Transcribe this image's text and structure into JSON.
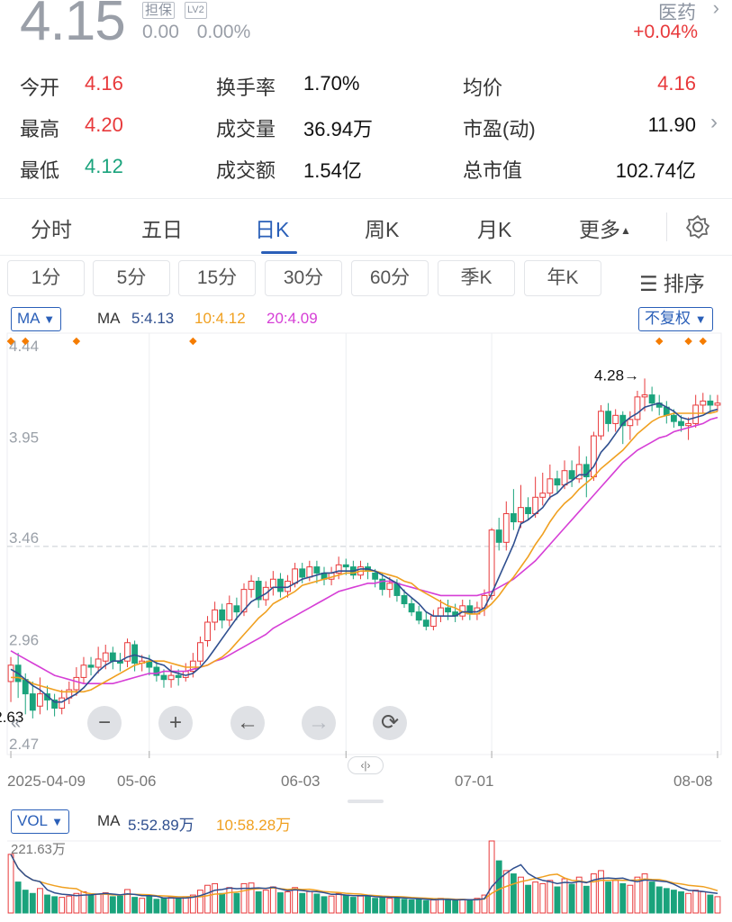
{
  "header": {
    "price": "4.15",
    "tags": [
      "担保",
      "LV2"
    ],
    "change": "0.00",
    "change_pct": "0.00%",
    "sector": "医药",
    "sector_pct": "+0.04%"
  },
  "quote": {
    "open": {
      "label": "今开",
      "value": "4.16"
    },
    "high": {
      "label": "最高",
      "value": "4.20"
    },
    "low": {
      "label": "最低",
      "value": "4.12"
    },
    "turnover": {
      "label": "换手率",
      "value": "1.70%"
    },
    "volume": {
      "label": "成交量",
      "value": "36.94万"
    },
    "amount": {
      "label": "成交额",
      "value": "1.54亿"
    },
    "avg": {
      "label": "均价",
      "value": "4.16"
    },
    "pe": {
      "label": "市盈(动)",
      "value": "11.90"
    },
    "mktcap": {
      "label": "总市值",
      "value": "102.74亿"
    }
  },
  "tabs": [
    "分时",
    "五日",
    "日K",
    "周K",
    "月K",
    "更多"
  ],
  "periods": [
    "1分",
    "5分",
    "15分",
    "30分",
    "60分",
    "季K",
    "年K"
  ],
  "sort_label": "排序",
  "ma": {
    "button": "MA",
    "label": "MA",
    "ma5": "5:4.13",
    "ma10": "10:4.12",
    "ma20": "20:4.09",
    "adjust": "不复权"
  },
  "vol": {
    "button": "VOL",
    "label": "MA",
    "ma5": "5:52.89万",
    "ma10": "10:58.28万",
    "max": "221.63万"
  },
  "chart_data": {
    "type": "candlestick",
    "y_ticks": [
      "4.44",
      "3.95",
      "3.46",
      "2.96",
      "2.47"
    ],
    "ylim": [
      2.47,
      4.44
    ],
    "x_ticks": [
      "2025-04-09",
      "05-06",
      "06-03",
      "07-01",
      "08-08"
    ],
    "annotations": {
      "high": "4.28",
      "low": "2.63"
    },
    "candles": [
      [
        2.8,
        2.88,
        2.7,
        2.92
      ],
      [
        2.88,
        2.8,
        2.72,
        2.94
      ],
      [
        2.81,
        2.74,
        2.64,
        2.84
      ],
      [
        2.74,
        2.66,
        2.62,
        2.8
      ],
      [
        2.68,
        2.74,
        2.64,
        2.82
      ],
      [
        2.74,
        2.71,
        2.66,
        2.78
      ],
      [
        2.71,
        2.67,
        2.63,
        2.74
      ],
      [
        2.67,
        2.72,
        2.64,
        2.76
      ],
      [
        2.72,
        2.76,
        2.69,
        2.8
      ],
      [
        2.76,
        2.82,
        2.73,
        2.87
      ],
      [
        2.82,
        2.88,
        2.79,
        2.92
      ],
      [
        2.88,
        2.87,
        2.83,
        2.92
      ],
      [
        2.87,
        2.91,
        2.84,
        2.97
      ],
      [
        2.9,
        2.94,
        2.86,
        2.98
      ],
      [
        2.94,
        2.9,
        2.86,
        2.97
      ],
      [
        2.9,
        2.89,
        2.85,
        2.94
      ],
      [
        2.9,
        2.99,
        2.87,
        3.01
      ],
      [
        2.98,
        2.89,
        2.85,
        3.0
      ],
      [
        2.89,
        2.9,
        2.85,
        2.93
      ],
      [
        2.9,
        2.87,
        2.83,
        2.93
      ],
      [
        2.87,
        2.83,
        2.8,
        2.9
      ],
      [
        2.83,
        2.81,
        2.77,
        2.86
      ],
      [
        2.81,
        2.83,
        2.77,
        2.88
      ],
      [
        2.83,
        2.82,
        2.78,
        2.86
      ],
      [
        2.82,
        2.85,
        2.8,
        2.89
      ],
      [
        2.85,
        2.9,
        2.82,
        2.94
      ],
      [
        2.9,
        2.99,
        2.88,
        3.02
      ],
      [
        3.0,
        3.09,
        2.97,
        3.12
      ],
      [
        3.09,
        3.15,
        3.05,
        3.19
      ],
      [
        3.15,
        3.1,
        3.06,
        3.18
      ],
      [
        3.1,
        3.18,
        3.07,
        3.22
      ],
      [
        3.17,
        3.14,
        3.1,
        3.21
      ],
      [
        3.14,
        3.25,
        3.12,
        3.28
      ],
      [
        3.25,
        3.29,
        3.21,
        3.32
      ],
      [
        3.29,
        3.2,
        3.16,
        3.31
      ],
      [
        3.2,
        3.26,
        3.17,
        3.29
      ],
      [
        3.26,
        3.3,
        3.22,
        3.34
      ],
      [
        3.3,
        3.24,
        3.21,
        3.33
      ],
      [
        3.24,
        3.29,
        3.21,
        3.32
      ],
      [
        3.28,
        3.35,
        3.26,
        3.38
      ],
      [
        3.35,
        3.31,
        3.28,
        3.38
      ],
      [
        3.31,
        3.36,
        3.29,
        3.39
      ],
      [
        3.36,
        3.33,
        3.28,
        3.39
      ],
      [
        3.33,
        3.3,
        3.27,
        3.36
      ],
      [
        3.3,
        3.33,
        3.27,
        3.36
      ],
      [
        3.33,
        3.37,
        3.3,
        3.41
      ],
      [
        3.37,
        3.36,
        3.32,
        3.4
      ],
      [
        3.36,
        3.32,
        3.3,
        3.39
      ],
      [
        3.32,
        3.36,
        3.3,
        3.39
      ],
      [
        3.36,
        3.34,
        3.3,
        3.38
      ],
      [
        3.33,
        3.3,
        3.26,
        3.35
      ],
      [
        3.3,
        3.25,
        3.22,
        3.33
      ],
      [
        3.25,
        3.28,
        3.21,
        3.31
      ],
      [
        3.28,
        3.22,
        3.19,
        3.3
      ],
      [
        3.22,
        3.18,
        3.16,
        3.25
      ],
      [
        3.18,
        3.14,
        3.12,
        3.21
      ],
      [
        3.14,
        3.1,
        3.08,
        3.17
      ],
      [
        3.1,
        3.07,
        3.05,
        3.14
      ],
      [
        3.07,
        3.12,
        3.05,
        3.15
      ],
      [
        3.12,
        3.16,
        3.09,
        3.2
      ],
      [
        3.16,
        3.14,
        3.1,
        3.2
      ],
      [
        3.14,
        3.12,
        3.09,
        3.18
      ],
      [
        3.12,
        3.17,
        3.1,
        3.2
      ],
      [
        3.17,
        3.13,
        3.1,
        3.2
      ],
      [
        3.13,
        3.16,
        3.1,
        3.19
      ],
      [
        3.16,
        3.22,
        3.12,
        3.25
      ],
      [
        3.22,
        3.54,
        3.2,
        3.55
      ],
      [
        3.54,
        3.48,
        3.44,
        3.6
      ],
      [
        3.48,
        3.62,
        3.44,
        3.68
      ],
      [
        3.62,
        3.58,
        3.54,
        3.74
      ],
      [
        3.58,
        3.65,
        3.55,
        3.76
      ],
      [
        3.65,
        3.62,
        3.59,
        3.7
      ],
      [
        3.62,
        3.7,
        3.6,
        3.8
      ],
      [
        3.7,
        3.72,
        3.66,
        3.82
      ],
      [
        3.72,
        3.79,
        3.69,
        3.86
      ],
      [
        3.79,
        3.76,
        3.72,
        3.83
      ],
      [
        3.76,
        3.83,
        3.74,
        3.88
      ],
      [
        3.83,
        3.79,
        3.75,
        3.88
      ],
      [
        3.79,
        3.86,
        3.77,
        3.95
      ],
      [
        3.86,
        3.8,
        3.7,
        3.9
      ],
      [
        3.8,
        4.0,
        3.78,
        4.02
      ],
      [
        4.0,
        4.12,
        3.98,
        4.15
      ],
      [
        4.12,
        4.06,
        4.02,
        4.16
      ],
      [
        4.06,
        4.1,
        4.02,
        4.13
      ],
      [
        4.1,
        4.05,
        3.96,
        4.12
      ],
      [
        4.05,
        4.08,
        3.98,
        4.12
      ],
      [
        4.08,
        4.19,
        4.05,
        4.22
      ],
      [
        4.19,
        4.2,
        4.12,
        4.28
      ],
      [
        4.2,
        4.16,
        4.12,
        4.24
      ],
      [
        4.16,
        4.14,
        4.1,
        4.2
      ],
      [
        4.14,
        4.1,
        4.06,
        4.17
      ],
      [
        4.1,
        4.07,
        4.04,
        4.13
      ],
      [
        4.07,
        4.05,
        4.02,
        4.1
      ],
      [
        4.05,
        4.06,
        3.98,
        4.09
      ],
      [
        4.06,
        4.15,
        4.04,
        4.2
      ],
      [
        4.15,
        4.17,
        4.11,
        4.21
      ],
      [
        4.17,
        4.15,
        4.11,
        4.2
      ],
      [
        4.15,
        4.16,
        4.12,
        4.2
      ]
    ],
    "ma5": [
      2.86,
      2.84,
      2.81,
      2.78,
      2.76,
      2.73,
      2.7,
      2.7,
      2.72,
      2.74,
      2.77,
      2.81,
      2.85,
      2.88,
      2.9,
      2.9,
      2.92,
      2.93,
      2.92,
      2.91,
      2.89,
      2.88,
      2.85,
      2.84,
      2.83,
      2.84,
      2.87,
      2.91,
      2.96,
      3.01,
      3.06,
      3.11,
      3.15,
      3.19,
      3.21,
      3.23,
      3.26,
      3.26,
      3.26,
      3.28,
      3.3,
      3.31,
      3.32,
      3.33,
      3.33,
      3.34,
      3.34,
      3.34,
      3.35,
      3.35,
      3.34,
      3.32,
      3.3,
      3.28,
      3.24,
      3.21,
      3.18,
      3.14,
      3.12,
      3.12,
      3.12,
      3.12,
      3.14,
      3.14,
      3.14,
      3.16,
      3.23,
      3.31,
      3.39,
      3.47,
      3.57,
      3.59,
      3.62,
      3.65,
      3.7,
      3.72,
      3.76,
      3.78,
      3.81,
      3.81,
      3.85,
      3.92,
      3.96,
      4.01,
      4.06,
      4.09,
      4.11,
      4.14,
      4.15,
      4.16,
      4.14,
      4.12,
      4.09,
      4.08,
      4.09,
      4.1,
      4.12,
      4.13
    ],
    "ma10": [
      2.82,
      2.82,
      2.81,
      2.79,
      2.78,
      2.77,
      2.76,
      2.75,
      2.75,
      2.75,
      2.75,
      2.76,
      2.78,
      2.8,
      2.82,
      2.84,
      2.86,
      2.88,
      2.89,
      2.9,
      2.9,
      2.9,
      2.89,
      2.88,
      2.87,
      2.87,
      2.87,
      2.88,
      2.9,
      2.92,
      2.95,
      2.99,
      3.03,
      3.07,
      3.11,
      3.14,
      3.18,
      3.2,
      3.22,
      3.24,
      3.27,
      3.28,
      3.29,
      3.3,
      3.31,
      3.32,
      3.33,
      3.33,
      3.34,
      3.34,
      3.34,
      3.33,
      3.32,
      3.31,
      3.29,
      3.28,
      3.25,
      3.23,
      3.21,
      3.19,
      3.17,
      3.16,
      3.14,
      3.13,
      3.13,
      3.15,
      3.18,
      3.22,
      3.27,
      3.31,
      3.36,
      3.41,
      3.47,
      3.52,
      3.58,
      3.63,
      3.67,
      3.7,
      3.74,
      3.77,
      3.8,
      3.84,
      3.87,
      3.9,
      3.93,
      3.97,
      4.01,
      4.04,
      4.07,
      4.09,
      4.1,
      4.11,
      4.11,
      4.11,
      4.11,
      4.11,
      4.11,
      4.12
    ],
    "ma20": [
      2.95,
      2.93,
      2.91,
      2.89,
      2.87,
      2.85,
      2.83,
      2.82,
      2.81,
      2.8,
      2.79,
      2.79,
      2.79,
      2.79,
      2.79,
      2.8,
      2.81,
      2.82,
      2.83,
      2.84,
      2.84,
      2.85,
      2.85,
      2.85,
      2.85,
      2.86,
      2.87,
      2.88,
      2.9,
      2.91,
      2.93,
      2.95,
      2.97,
      2.99,
      3.01,
      3.03,
      3.06,
      3.08,
      3.1,
      3.12,
      3.14,
      3.16,
      3.18,
      3.2,
      3.22,
      3.24,
      3.25,
      3.26,
      3.27,
      3.28,
      3.28,
      3.29,
      3.29,
      3.28,
      3.27,
      3.26,
      3.25,
      3.24,
      3.23,
      3.22,
      3.22,
      3.22,
      3.22,
      3.22,
      3.22,
      3.23,
      3.24,
      3.26,
      3.28,
      3.3,
      3.33,
      3.36,
      3.39,
      3.43,
      3.47,
      3.51,
      3.55,
      3.59,
      3.63,
      3.67,
      3.71,
      3.75,
      3.79,
      3.83,
      3.87,
      3.9,
      3.93,
      3.95,
      3.97,
      3.99,
      4.0,
      4.02,
      4.03,
      4.04,
      4.05,
      4.06,
      4.08,
      4.09
    ],
    "volume_wan": [
      180,
      95,
      70,
      60,
      75,
      55,
      50,
      48,
      52,
      60,
      65,
      55,
      58,
      62,
      50,
      52,
      72,
      48,
      45,
      50,
      42,
      45,
      48,
      44,
      50,
      55,
      70,
      85,
      90,
      60,
      78,
      60,
      90,
      92,
      65,
      70,
      80,
      62,
      65,
      78,
      60,
      66,
      58,
      50,
      52,
      60,
      55,
      48,
      52,
      50,
      45,
      50,
      45,
      48,
      42,
      40,
      45,
      38,
      40,
      45,
      40,
      38,
      42,
      40,
      45,
      55,
      221,
      160,
      130,
      120,
      110,
      85,
      95,
      90,
      100,
      80,
      105,
      88,
      110,
      82,
      120,
      130,
      95,
      100,
      90,
      85,
      110,
      120,
      95,
      80,
      75,
      70,
      65,
      60,
      70,
      65,
      55,
      50
    ]
  }
}
